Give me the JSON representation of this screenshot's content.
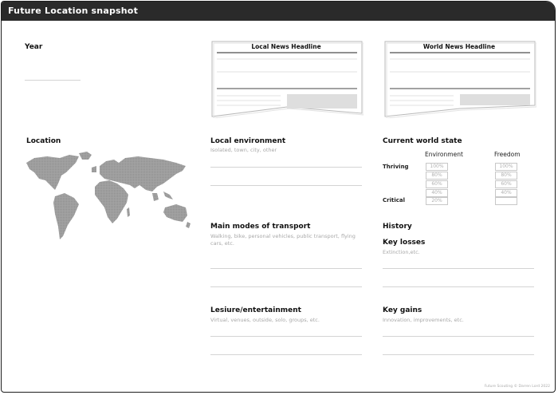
{
  "title": "Future Location snapshot",
  "year": {
    "label": "Year"
  },
  "location": {
    "label": "Location"
  },
  "headlines": {
    "local": "Local News Headline",
    "world": "World News Headline"
  },
  "local_environment": {
    "label": "Local environment",
    "hint": "Isolated, town, city, other"
  },
  "transport": {
    "label": "Main modes of transport",
    "hint": "Walking, bike, personal vehicles, public transport, flying cars, etc."
  },
  "leisure": {
    "label": "Lesiure/entertainment",
    "hint": "Virtual, venues, outside, solo, groups, etc."
  },
  "world_state": {
    "label": "Current world state",
    "environment": "Environment",
    "freedom": "Freedom",
    "thriving": "Thriving",
    "critical": "Critical",
    "environment_levels": [
      "100%",
      "80%",
      "60%",
      "40%",
      "20%"
    ],
    "freedom_levels": [
      "100%",
      "80%",
      "60%",
      "40%",
      ""
    ]
  },
  "history": {
    "label": "History",
    "losses_label": "Key losses",
    "losses_hint": "Extinction,etc.",
    "gains_label": "Key gains",
    "gains_hint": "Innovation, improvements, etc."
  },
  "credit": "Future Scouting © Darren Lord 2022",
  "colors": {
    "titlebar": "#2a2a2a",
    "map": "#999999",
    "line": "#d4d4d4"
  }
}
